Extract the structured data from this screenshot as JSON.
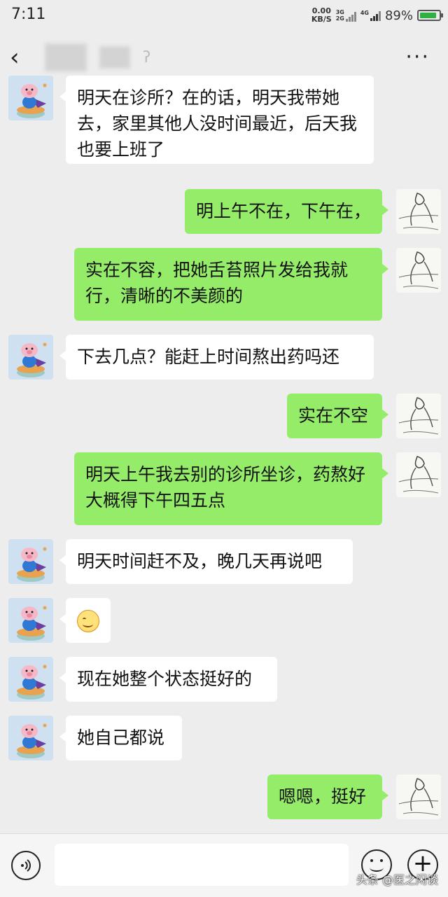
{
  "status_bar": {
    "time": "7:11",
    "net_speed_value": "0.00",
    "net_speed_unit": "KB/S",
    "signal1_labels": [
      "3G",
      "2G"
    ],
    "signal2_label": "4G",
    "battery_percent": "89%",
    "battery_level": 0.89
  },
  "nav": {
    "back_icon": "chevron-left-icon",
    "more_icon": "more-dots-icon"
  },
  "messages": [
    {
      "side": "left",
      "text": "明天在诊所？在的话，明天我带她去，家里其他人没时间最近，后天我也要上班了"
    },
    {
      "side": "right",
      "text": "明上午不在，下午在，"
    },
    {
      "side": "right",
      "text": "实在不容，把她舌苔照片发给我就行，清晰的不美颜的"
    },
    {
      "side": "left",
      "text": "下去几点？能赶上时间熬出药吗还"
    },
    {
      "side": "right",
      "text": "实在不空"
    },
    {
      "side": "right",
      "text": "明天上午我去别的诊所坐诊，药熬好大概得下午四五点"
    },
    {
      "side": "left",
      "text": "明天时间赶不及，晚几天再说吧"
    },
    {
      "side": "left",
      "text": "",
      "emoji": "smile-emoji-icon"
    },
    {
      "side": "left",
      "text": "现在她整个状态挺好的"
    },
    {
      "side": "left",
      "text": "她自己都说"
    },
    {
      "side": "right",
      "text": "嗯嗯，挺好"
    }
  ],
  "input_bar": {
    "voice_icon": "voice-icon",
    "emoji_icon": "emoji-icon",
    "plus_icon": "plus-icon",
    "watermark": "头条 @医之闲谈"
  },
  "colors": {
    "background": "#ededed",
    "bubble_self": "#95ec69",
    "bubble_other": "#ffffff"
  }
}
